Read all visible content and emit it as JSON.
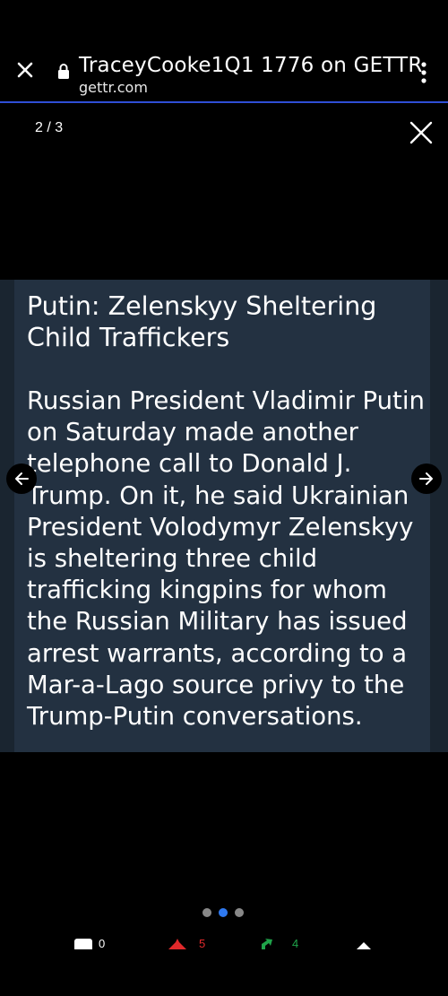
{
  "browser": {
    "title": "TraceyCooke1Q1 1776 on GETTR",
    "url": "gettr.com"
  },
  "viewer": {
    "counter": "2 / 3",
    "dots": [
      false,
      true,
      false
    ]
  },
  "slide": {
    "headline": "Putin: Zelenskyy Sheltering Child Traffickers",
    "body": "Russian President Vladimir Putin on Saturday made another telephone call to Donald J. Trump. On it, he said Ukrainian President Volodymyr Zelenskyy is sheltering three child trafficking kingpins for whom the Russian Military has issued arrest warrants, according to a Mar-a-Lago source privy to the Trump-Putin conversations."
  },
  "actions": [
    {
      "icon": "comment-icon",
      "count": "0",
      "color": "#ffffff"
    },
    {
      "icon": "like-icon",
      "count": "5",
      "color": "#e0292b"
    },
    {
      "icon": "repost-icon",
      "count": "4",
      "color": "#1fa34a"
    },
    {
      "icon": "share-icon",
      "count": "",
      "color": "#ffffff"
    }
  ],
  "colors": {
    "accent_line": "#2f4fd6",
    "active_dot": "#2f79f0",
    "slide_bg": "#233141"
  }
}
